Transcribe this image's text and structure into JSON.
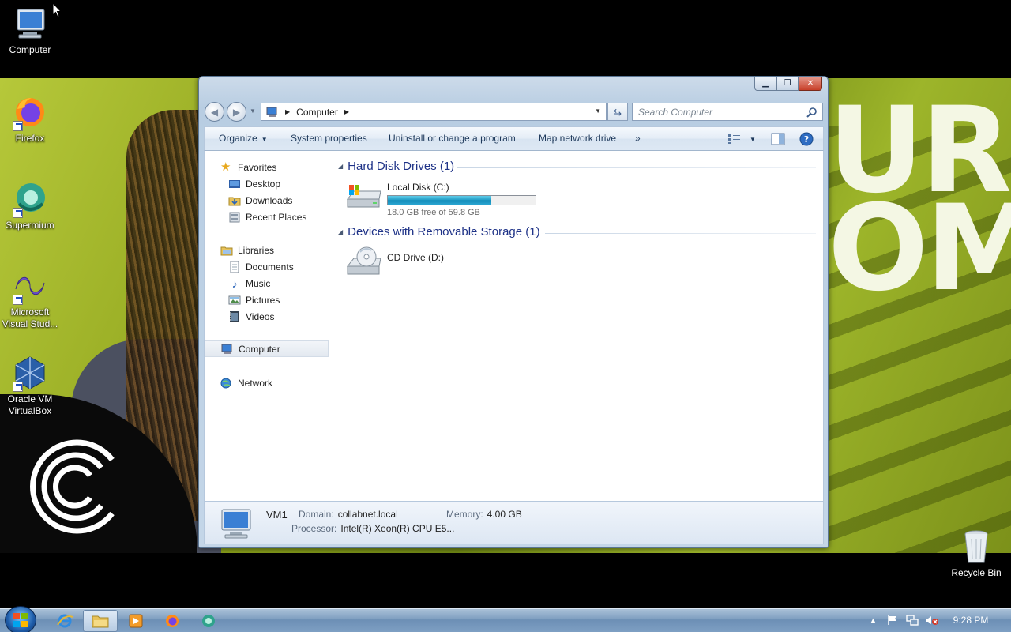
{
  "desktop": {
    "icons": [
      {
        "label": "Computer"
      },
      {
        "label": "Firefox"
      },
      {
        "label": "Supermium"
      },
      {
        "label": "Microsoft Visual Stud..."
      },
      {
        "label": "Oracle VM VirtualBox"
      },
      {
        "label": "Recycle Bin"
      }
    ],
    "wallpaper_text": "UR\nOM"
  },
  "window": {
    "caption_buttons": {
      "minimize": "minimize-icon",
      "maximize": "maximize-icon",
      "close": "close-icon"
    },
    "address": {
      "crumb": "Computer"
    },
    "search": {
      "placeholder": "Search Computer"
    },
    "toolbar": {
      "organize": "Organize",
      "system_properties": "System properties",
      "uninstall": "Uninstall or change a program",
      "map_drive": "Map network drive",
      "more": "»"
    },
    "nav": {
      "favorites": "Favorites",
      "desktop": "Desktop",
      "downloads": "Downloads",
      "recent": "Recent Places",
      "libraries": "Libraries",
      "documents": "Documents",
      "music": "Music",
      "pictures": "Pictures",
      "videos": "Videos",
      "computer": "Computer",
      "network": "Network"
    },
    "groups": {
      "hdd": "Hard Disk Drives (1)",
      "removable": "Devices with Removable Storage (1)"
    },
    "drives": {
      "c": {
        "name": "Local Disk (C:)",
        "free": "18.0 GB free of 59.8 GB",
        "used_fraction": 0.7
      },
      "d": {
        "name": "CD Drive (D:)"
      }
    },
    "details": {
      "name": "VM1",
      "domain_label": "Domain:",
      "domain": "collabnet.local",
      "memory_label": "Memory:",
      "memory": "4.00 GB",
      "processor_label": "Processor:",
      "processor": "Intel(R) Xeon(R) CPU E5..."
    }
  },
  "taskbar": {
    "clock": "9:28 PM",
    "show_hidden": "▲"
  },
  "colors": {
    "accent": "#1e3287",
    "bar_fill": "#1f9ac4",
    "taskbar": "#7d9dbf"
  }
}
